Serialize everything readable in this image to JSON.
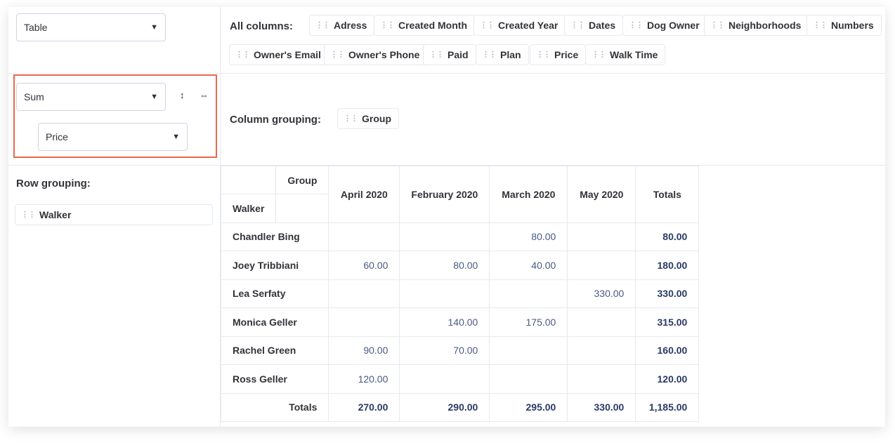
{
  "view_select": {
    "value": "Table"
  },
  "aggregation": {
    "function": "Sum",
    "field": "Price"
  },
  "all_columns": {
    "label": "All columns:",
    "chips": [
      "Adress",
      "Created Month",
      "Created Year",
      "Dates",
      "Dog Owner",
      "Neighborhoods",
      "Numbers",
      "Owner's Email",
      "Owner's Phone",
      "Paid",
      "Plan",
      "Price",
      "Walk Time"
    ]
  },
  "column_grouping": {
    "label": "Column grouping:",
    "chip": "Group"
  },
  "row_grouping": {
    "label": "Row grouping:",
    "chip": "Walker"
  },
  "pivot": {
    "corner_group": "Group",
    "corner_walker": "Walker",
    "columns": [
      "April 2020",
      "February 2020",
      "March 2020",
      "May 2020"
    ],
    "totals_label": "Totals",
    "rows": [
      {
        "walker": "Chandler Bing",
        "values": [
          "",
          "",
          "80.00",
          ""
        ],
        "total": "80.00"
      },
      {
        "walker": "Joey Tribbiani",
        "values": [
          "60.00",
          "80.00",
          "40.00",
          ""
        ],
        "total": "180.00"
      },
      {
        "walker": "Lea Serfaty",
        "values": [
          "",
          "",
          "",
          "330.00"
        ],
        "total": "330.00"
      },
      {
        "walker": "Monica Geller",
        "values": [
          "",
          "140.00",
          "175.00",
          ""
        ],
        "total": "315.00"
      },
      {
        "walker": "Rachel Green",
        "values": [
          "90.00",
          "70.00",
          "",
          ""
        ],
        "total": "160.00"
      },
      {
        "walker": "Ross Geller",
        "values": [
          "120.00",
          "",
          "",
          ""
        ],
        "total": "120.00"
      }
    ],
    "column_totals": [
      "270.00",
      "290.00",
      "295.00",
      "330.00"
    ],
    "grand_total": "1,185.00"
  },
  "icons": {
    "caret": "caret-down-icon",
    "sort_vertical": "vertical-arrows-icon",
    "sort_horizontal": "horizontal-arrows-icon",
    "grip": "drag-handle-icon"
  },
  "colors": {
    "highlight_border": "#e8684a",
    "value_text": "#4a5a85",
    "total_text": "#2a3a65"
  }
}
